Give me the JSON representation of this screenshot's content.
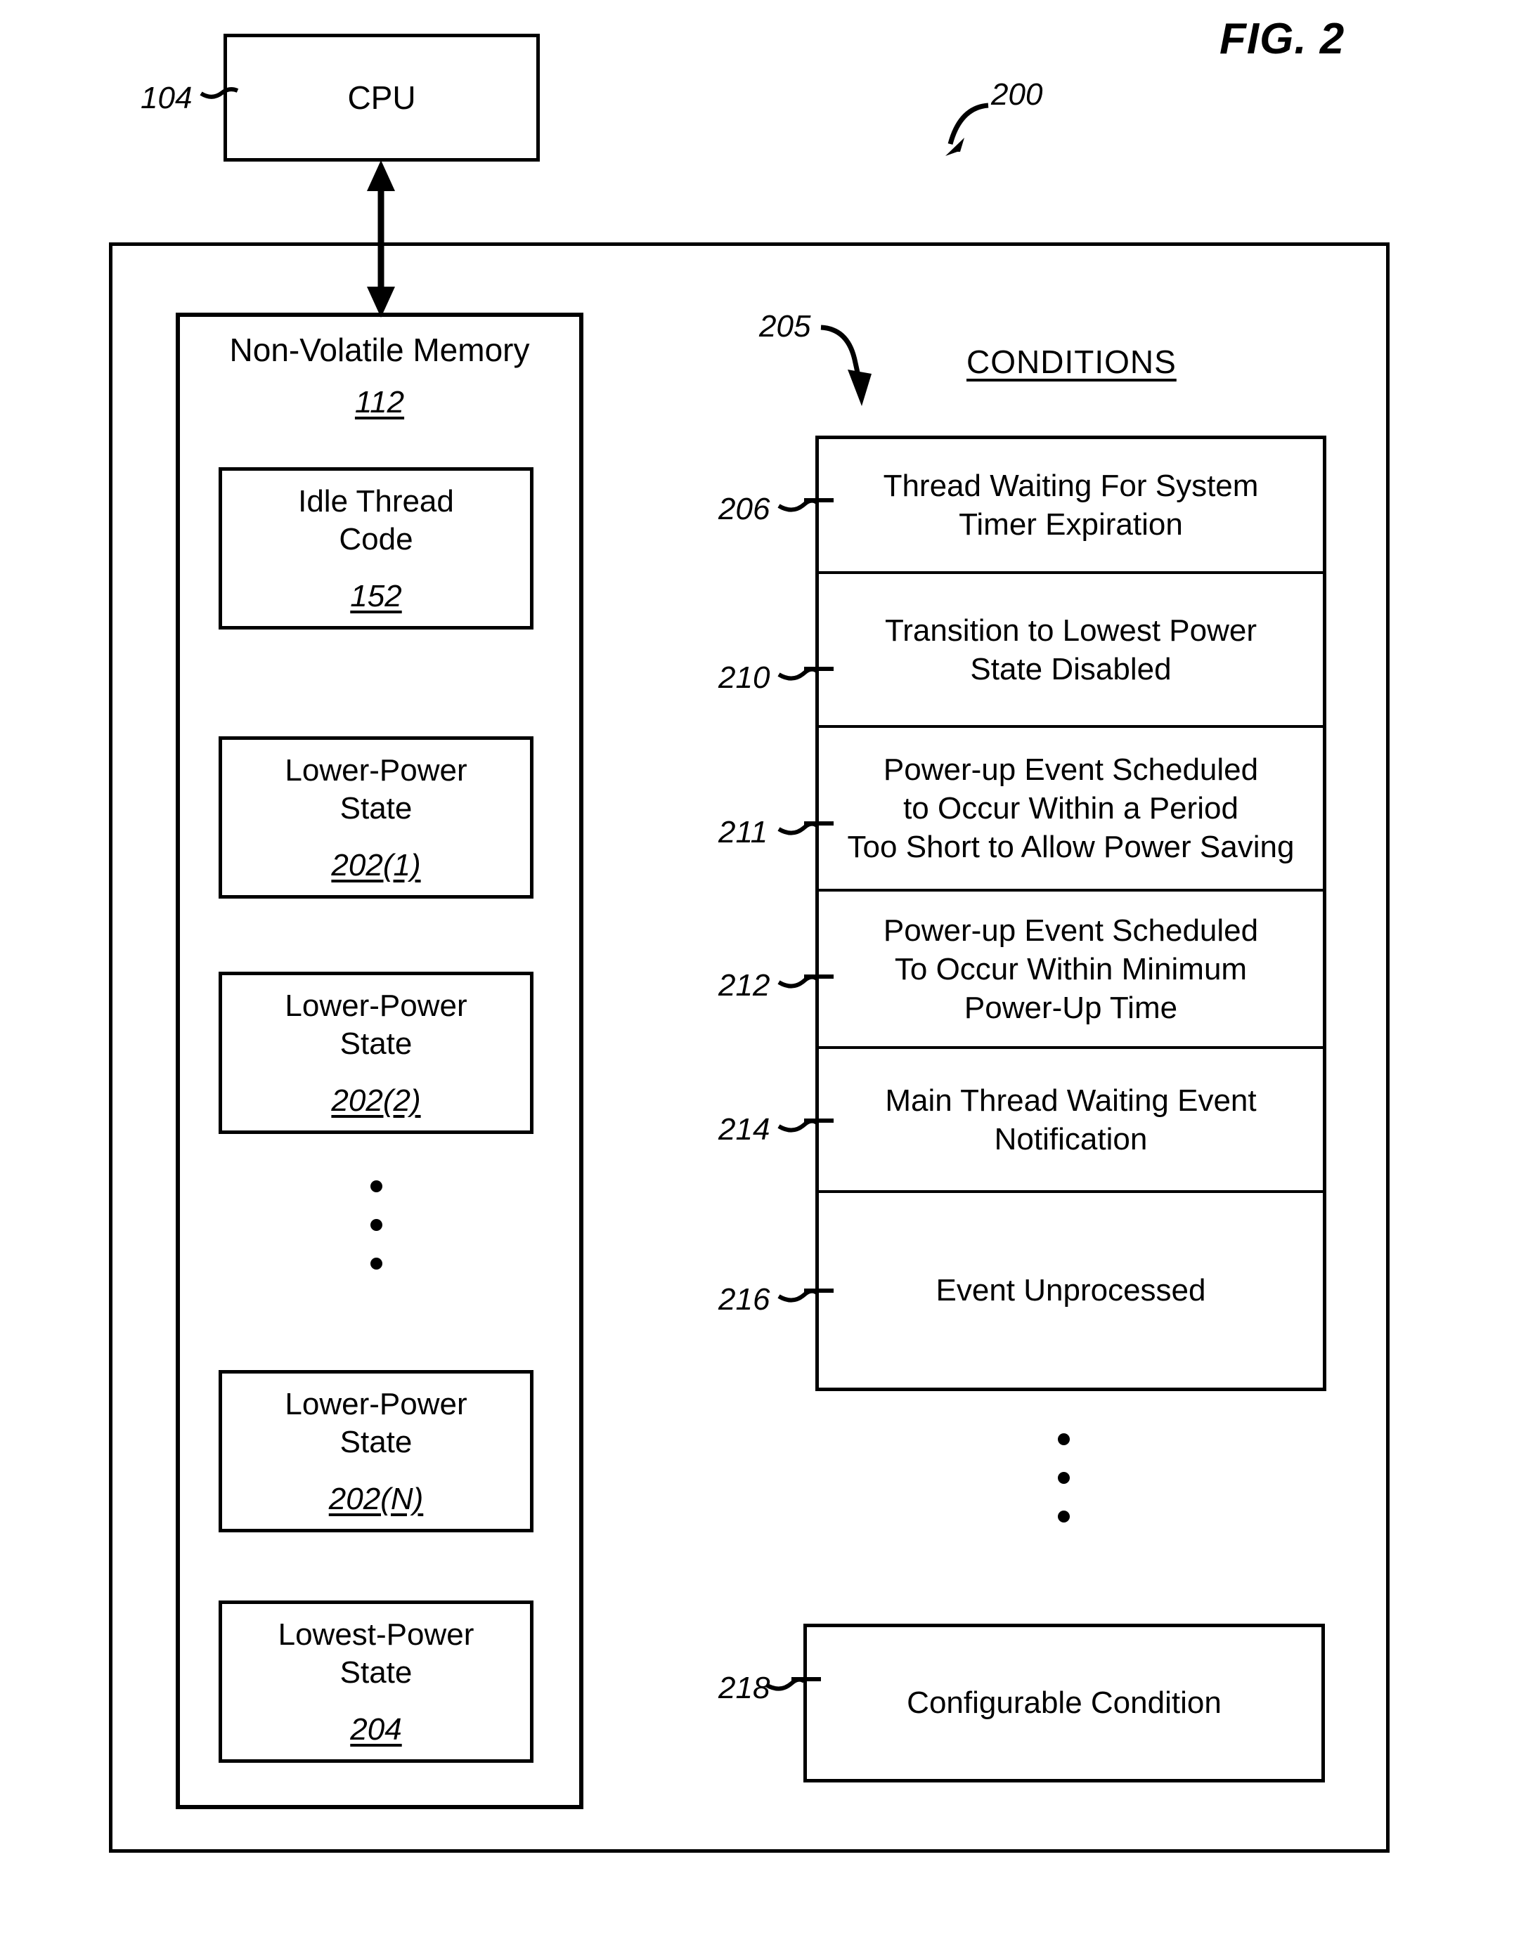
{
  "figure": {
    "title": "FIG. 2",
    "system_ref": "200"
  },
  "cpu": {
    "ref": "104",
    "label": "CPU"
  },
  "memory": {
    "ref": "112",
    "title": "Non-Volatile Memory",
    "blocks": [
      {
        "label": "Idle Thread\nCode",
        "ref": "152"
      },
      {
        "label": "Lower-Power\nState",
        "ref": "202(1)"
      },
      {
        "label": "Lower-Power\nState",
        "ref": "202(2)"
      },
      {
        "label": "Lower-Power\nState",
        "ref": "202(N)"
      },
      {
        "label": "Lowest-Power\nState",
        "ref": "204"
      }
    ],
    "ellipsis_dots": 3
  },
  "conditions": {
    "ref": "205",
    "heading": "CONDITIONS",
    "items": [
      {
        "ref": "206",
        "text": "Thread Waiting For System\nTimer Expiration"
      },
      {
        "ref": "210",
        "text": "Transition to Lowest Power\nState Disabled"
      },
      {
        "ref": "211",
        "text": "Power-up Event Scheduled\nto Occur Within a Period\nToo Short to Allow Power Saving"
      },
      {
        "ref": "212",
        "text": "Power-up Event Scheduled\nTo Occur Within Minimum\nPower-Up Time"
      },
      {
        "ref": "214",
        "text": "Main Thread Waiting Event\nNotification"
      },
      {
        "ref": "216",
        "text": "Event Unprocessed"
      }
    ],
    "ellipsis_dots": 3,
    "configurable": {
      "ref": "218",
      "text": "Configurable Condition"
    }
  }
}
